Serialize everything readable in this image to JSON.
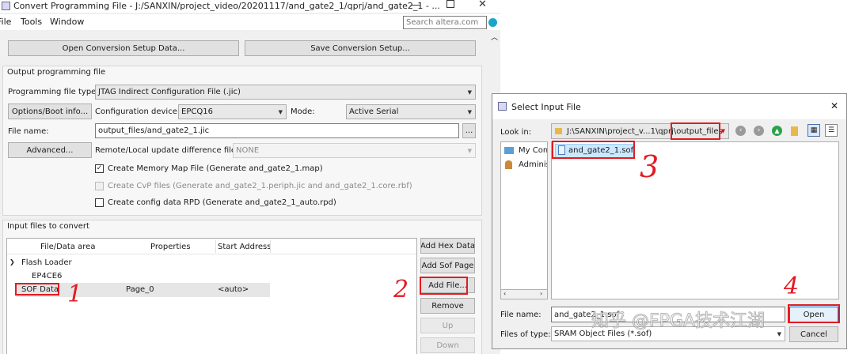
{
  "main_window": {
    "title": "Convert Programming File - J:/SANXIN/project_video/20201117/and_gate2_1/qprj/and_gate2_1 - ...",
    "menu": [
      "File",
      "Tools",
      "Window"
    ],
    "search_placeholder": "Search altera.com",
    "open_setup_label": "Open Conversion Setup Data...",
    "save_setup_label": "Save Conversion Setup...",
    "output_group_title": "Output programming file",
    "prog_type_label": "Programming file type:",
    "prog_type_value": "JTAG Indirect Configuration File (.jic)",
    "options_boot_label": "Options/Boot info...",
    "config_device_label": "Configuration device:",
    "config_device_value": "EPCQ16",
    "mode_label": "Mode:",
    "mode_value": "Active Serial",
    "file_name_label": "File name:",
    "file_name_value": "output_files/and_gate2_1.jic",
    "browse_label": "...",
    "advanced_label": "Advanced...",
    "remote_label": "Remote/Local update difference file:",
    "remote_value": "NONE",
    "cb_memory_map": "Create Memory Map File (Generate and_gate2_1.map)",
    "cb_cvp": "Create CvP files (Generate and_gate2_1.periph.jic and and_gate2_1.core.rbf)",
    "cb_rpd": "Create config data RPD (Generate and_gate2_1_auto.rpd)",
    "input_group_title": "Input files to convert",
    "table_headers": [
      "File/Data area",
      "Properties",
      "Start Address"
    ],
    "tree_flash_loader": "Flash Loader",
    "tree_device": "EP4CE6",
    "tree_sof_data": "SOF Data",
    "tree_sof_props": "Page_0",
    "tree_sof_addr": "<auto>",
    "btn_add_hex": "Add Hex Data",
    "btn_add_sof": "Add Sof Page",
    "btn_add_file": "Add File...",
    "btn_remove": "Remove",
    "btn_up": "Up",
    "btn_down": "Down"
  },
  "dialog": {
    "title": "Select Input File",
    "close_glyph": "✕",
    "look_in_label": "Look in:",
    "look_in_path": "J:\\SANXIN\\project_v...1\\qprj\\",
    "look_in_folder": "output_files",
    "sidebar_items": [
      "My Com",
      "Adminis"
    ],
    "file_item": "and_gate2_1.sof",
    "file_name_label": "File name:",
    "file_name_value": "and_gate2_1.sof",
    "files_of_type_label": "Files of type:",
    "files_of_type_value": "SRAM Object Files (*.sof)",
    "open_label": "Open",
    "cancel_label": "Cancel"
  },
  "annotations": {
    "n1": "1",
    "n2": "2",
    "n3": "3",
    "n4": "4"
  },
  "watermark": "知乎 @FPGA技术江湖",
  "colors": {
    "annotation_red": "#e31b23",
    "selection_blue": "#cce8ff",
    "window_bg": "#f0f0f0"
  }
}
